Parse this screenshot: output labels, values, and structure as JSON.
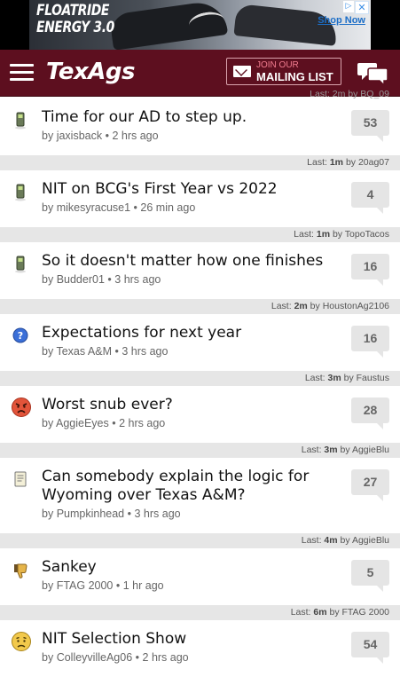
{
  "ad": {
    "headline": "FLOATRIDE\nENERGY 3.0",
    "cta": "Shop Now",
    "close": "✕",
    "info": "▷"
  },
  "header": {
    "logo": "TexAgs",
    "mailing_top": "JOIN OUR",
    "mailing_bottom": "MAILING LIST"
  },
  "top_partial_last": "Last: 2m by BQ_09",
  "threads": [
    {
      "icon": "phone-icon",
      "title": "Time for our AD to step up.",
      "author": "jaxisback",
      "age": "2 hrs ago",
      "count": "53",
      "last_time": "1m",
      "last_user": "20ag07"
    },
    {
      "icon": "phone-icon",
      "title": "NIT on BCG's First Year vs 2022",
      "author": "mikesyracuse1",
      "age": "26 min ago",
      "count": "4",
      "last_time": "1m",
      "last_user": "TopoTacos"
    },
    {
      "icon": "phone-icon",
      "title": "So it doesn't matter how one finishes",
      "author": "Budder01",
      "age": "3 hrs ago",
      "count": "16",
      "last_time": "2m",
      "last_user": "HoustonAg2106"
    },
    {
      "icon": "question-icon",
      "title": "Expectations for next year",
      "author": "Texas A&M",
      "age": "3 hrs ago",
      "count": "16",
      "last_time": "3m",
      "last_user": "Faustus"
    },
    {
      "icon": "angry-face-icon",
      "title": "Worst snub ever?",
      "author": "AggieEyes",
      "age": "2 hrs ago",
      "count": "28",
      "last_time": "3m",
      "last_user": "AggieBlu"
    },
    {
      "icon": "document-icon",
      "title": "Can somebody explain the logic for",
      "title2": "Wyoming over Texas A&M?",
      "author": "Pumpkinhead",
      "age": "3 hrs ago",
      "count": "27",
      "last_time": "4m",
      "last_user": "AggieBlu"
    },
    {
      "icon": "thumbs-down-icon",
      "title": "Sankey",
      "author": "FTAG 2000",
      "age": "1 hr ago",
      "count": "5",
      "last_time": "6m",
      "last_user": "FTAG 2000"
    },
    {
      "icon": "worried-face-icon",
      "title": "NIT Selection Show",
      "author": "ColleyvilleAg06",
      "age": "2 hrs ago",
      "count": "54"
    }
  ],
  "labels": {
    "by": "by",
    "sep": "•",
    "last": "Last:"
  }
}
